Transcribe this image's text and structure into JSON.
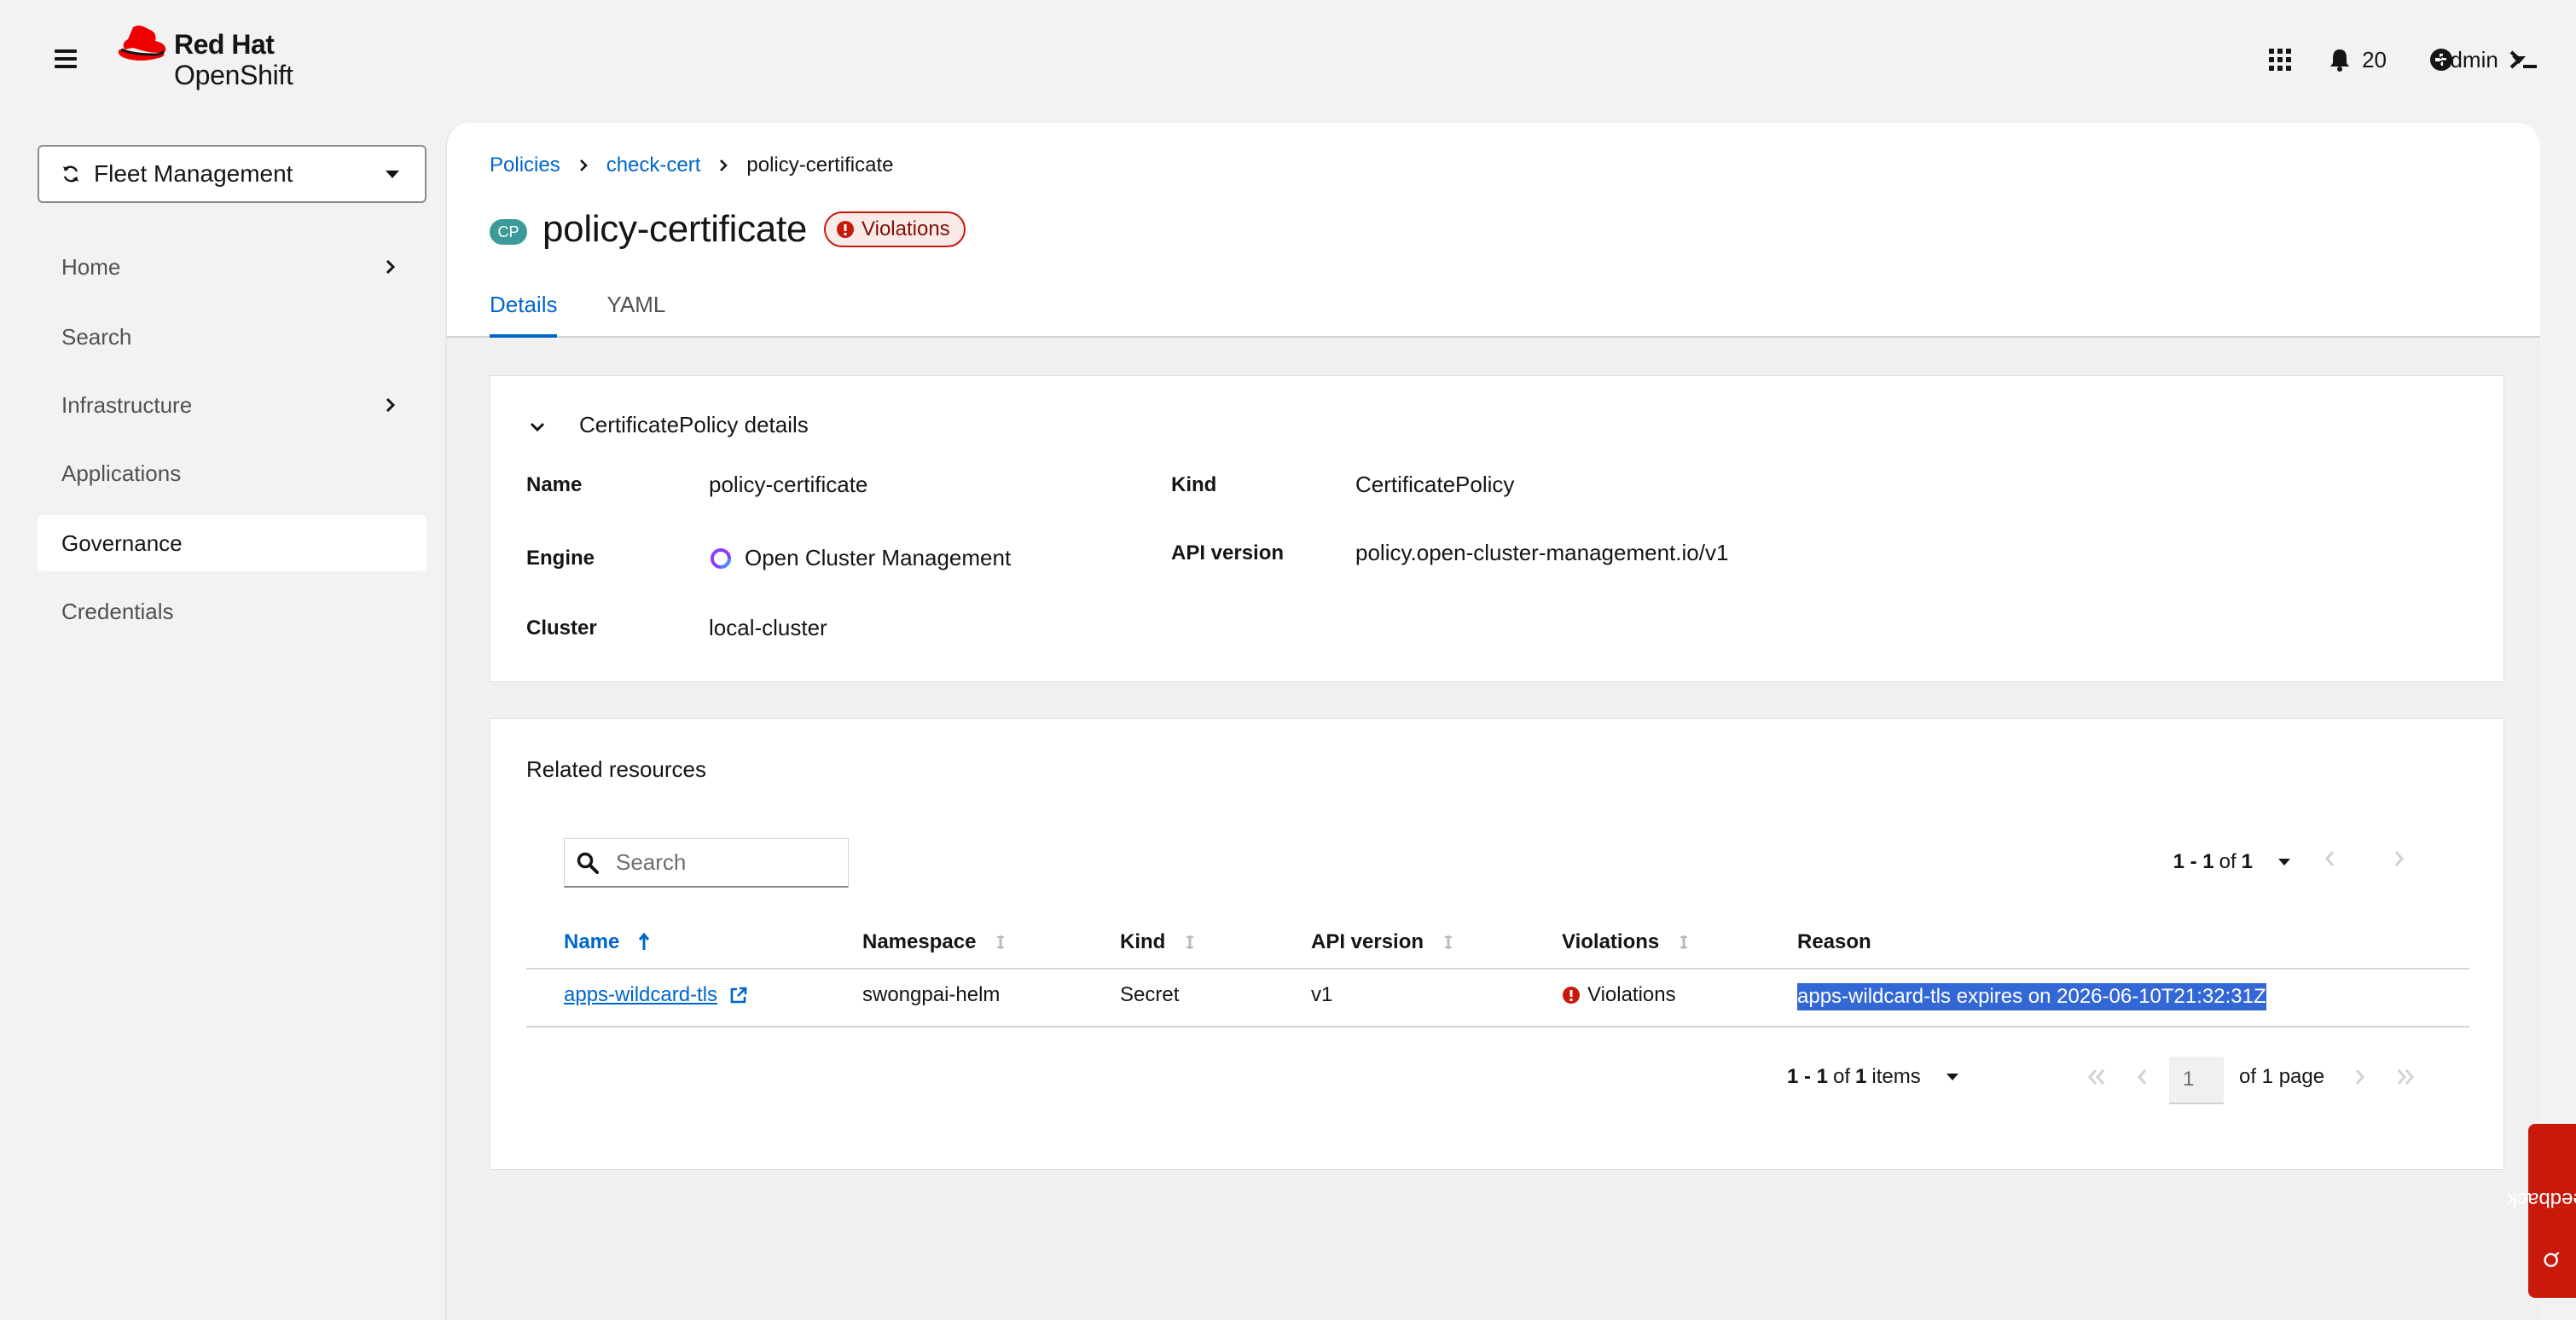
{
  "masthead": {
    "brand_line1": "Red Hat",
    "brand_line2": "OpenShift",
    "notifications_count": "20",
    "user": "admin"
  },
  "sidebar": {
    "perspective": "Fleet Management",
    "items": [
      {
        "label": "Home",
        "has_children": true
      },
      {
        "label": "Search",
        "has_children": false
      },
      {
        "label": "Infrastructure",
        "has_children": true
      },
      {
        "label": "Applications",
        "has_children": false
      },
      {
        "label": "Governance",
        "has_children": false,
        "active": true
      },
      {
        "label": "Credentials",
        "has_children": false
      }
    ]
  },
  "breadcrumb": {
    "items": [
      "Policies",
      "check-cert"
    ],
    "current": "policy-certificate"
  },
  "header": {
    "badge": "CP",
    "title": "policy-certificate",
    "status": "Violations"
  },
  "tabs": [
    {
      "label": "Details",
      "active": true
    },
    {
      "label": "YAML",
      "active": false
    }
  ],
  "details": {
    "title": "CertificatePolicy details",
    "name_label": "Name",
    "name": "policy-certificate",
    "engine_label": "Engine",
    "engine": "Open Cluster Management",
    "cluster_label": "Cluster",
    "cluster": "local-cluster",
    "kind_label": "Kind",
    "kind": "CertificatePolicy",
    "api_label": "API version",
    "api_version": "policy.open-cluster-management.io/v1"
  },
  "related": {
    "title": "Related resources",
    "search_placeholder": "Search",
    "pagination_top": {
      "range": "1 - 1",
      "of_word": "of",
      "total": "1"
    },
    "columns": [
      "Name",
      "Namespace",
      "Kind",
      "API version",
      "Violations",
      "Reason"
    ],
    "rows": [
      {
        "name": "apps-wildcard-tls",
        "namespace": "swongpai-helm",
        "kind": "Secret",
        "api_version": "v1",
        "violations": "Violations",
        "reason": "apps-wildcard-tls expires on 2026-06-10T21:32:31Z"
      }
    ],
    "pagination_bottom": {
      "range": "1 - 1",
      "of_word": "of",
      "total": "1",
      "items_word": "items",
      "page_value": "1",
      "of_pages": "of 1 page"
    }
  },
  "feedback": "Feedback",
  "colors": {
    "accent": "#0066cc",
    "danger": "#c9190b",
    "brand_red": "#ee0000",
    "cp_badge": "#3d9a9a"
  }
}
